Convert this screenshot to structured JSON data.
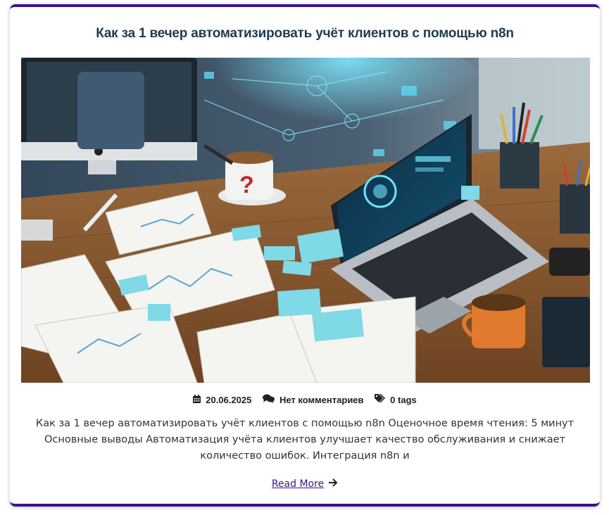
{
  "post": {
    "title": "Как за 1 вечер автоматизировать учёт клиентов с помощью n8n",
    "image_alt": "Ноутбук на деревянном столе с документами, стикерами и чашками кофе",
    "meta": {
      "date": "20.06.2025",
      "comments": "Нет комментариев",
      "tags": "0 tags",
      "date_icon": "calendar-icon",
      "comments_icon": "comments-icon",
      "tags_icon": "tags-icon"
    },
    "excerpt": "Как за 1 вечер автоматизировать учёт клиентов с помощью n8n Оценочное время чтения: 5 минут Основные выводы Автоматизация учёта клиентов улучшает качество обслуживания и снижает количество ошибок. Интеграция n8n и",
    "read_more": "Read More",
    "read_more_icon": "arrow-right-icon"
  },
  "colors": {
    "accent": "#3b1489",
    "title": "#1f3b50",
    "text": "#333333"
  }
}
